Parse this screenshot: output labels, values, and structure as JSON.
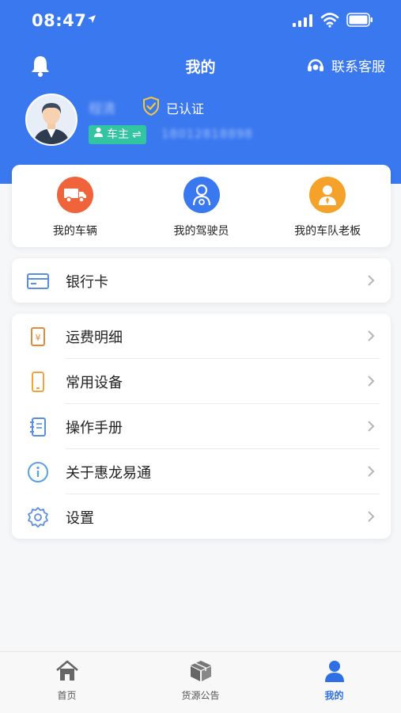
{
  "status_bar": {
    "time": "08:47"
  },
  "nav": {
    "title": "我的",
    "service_label": "联系客服"
  },
  "profile": {
    "name": "程清",
    "certified_label": "已认证",
    "role": "车主",
    "phone": "18012818898"
  },
  "quick_actions": [
    {
      "label": "我的车辆",
      "color": "#f0643c",
      "icon": "truck-icon"
    },
    {
      "label": "我的驾驶员",
      "color": "#3a78f0",
      "icon": "driver-icon"
    },
    {
      "label": "我的车队老板",
      "color": "#f5a22a",
      "icon": "boss-icon"
    }
  ],
  "bank": {
    "label": "银行卡",
    "icon": "bank-card-icon"
  },
  "menu": [
    {
      "label": "运费明细",
      "icon": "freight-bill-icon"
    },
    {
      "label": "常用设备",
      "icon": "phone-device-icon"
    },
    {
      "label": "操作手册",
      "icon": "manual-icon"
    },
    {
      "label": "关于惠龙易通",
      "icon": "info-icon"
    },
    {
      "label": "设置",
      "icon": "gear-icon"
    }
  ],
  "tabs": [
    {
      "label": "首页",
      "icon": "home-icon"
    },
    {
      "label": "货源公告",
      "icon": "box-icon"
    },
    {
      "label": "我的",
      "icon": "user-icon",
      "active": true
    }
  ],
  "colors": {
    "primary": "#3a78f0",
    "badge": "#33c4a2",
    "active_tab": "#2f6fe6"
  }
}
